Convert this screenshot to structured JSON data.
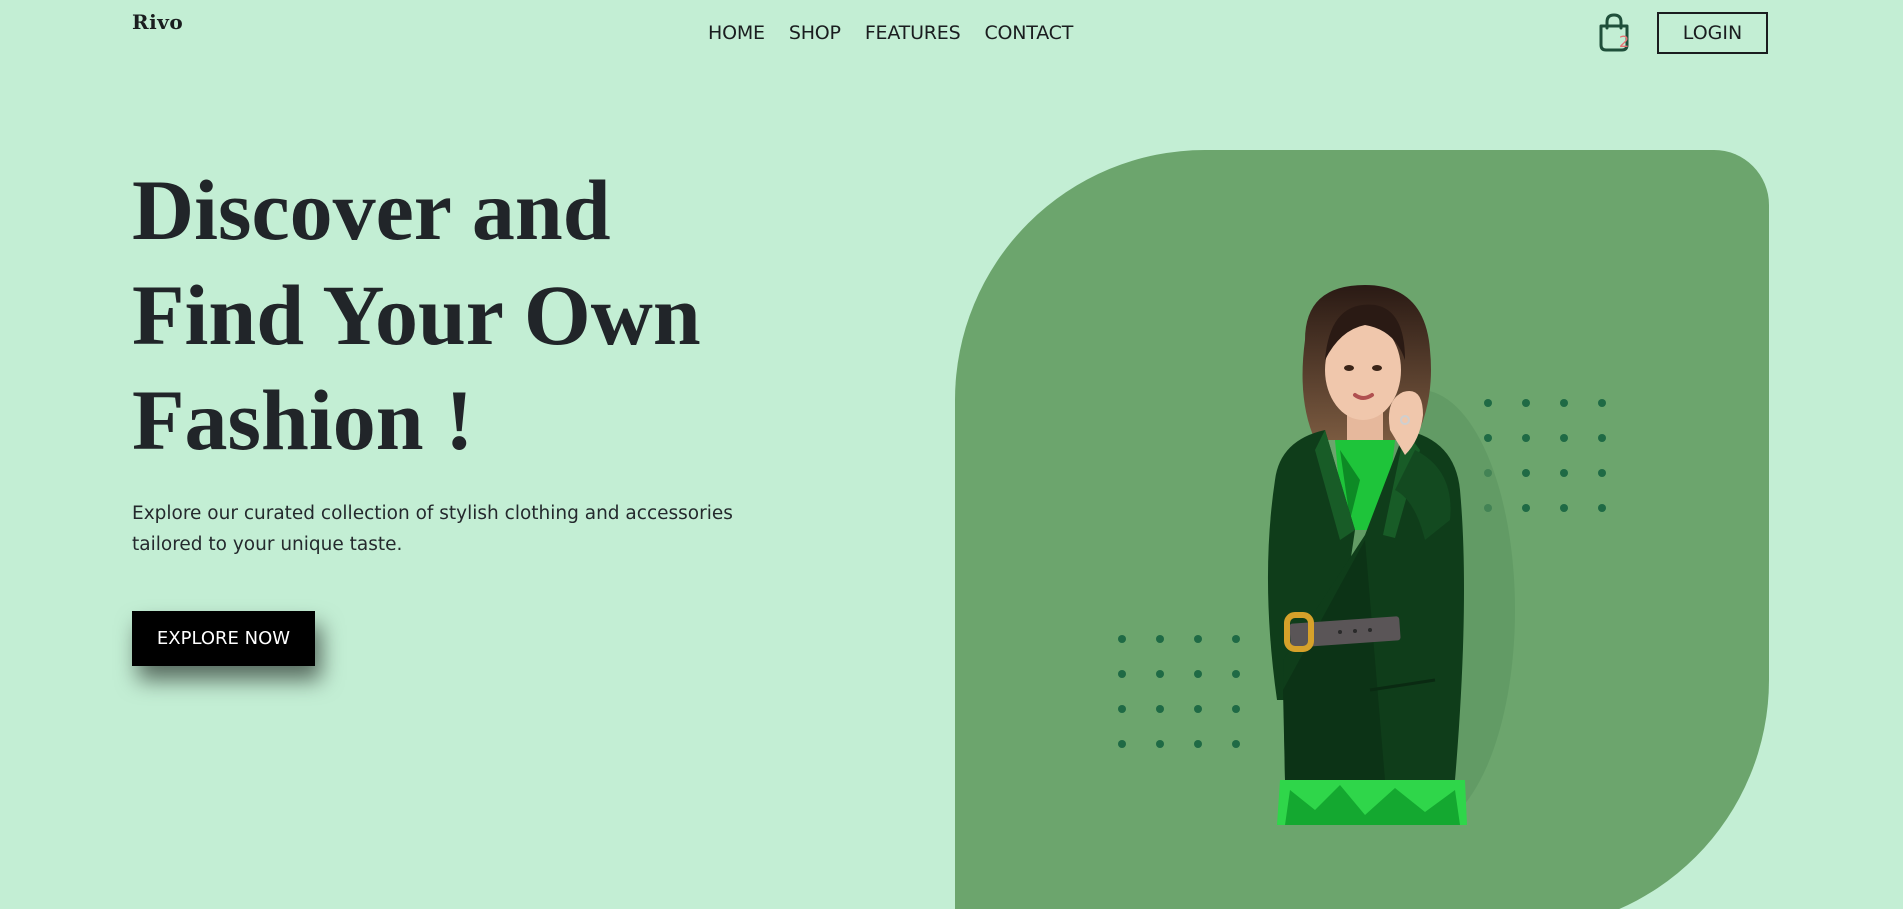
{
  "brand": {
    "name": "Rivo"
  },
  "nav": {
    "items": [
      {
        "label": "HOME"
      },
      {
        "label": "SHOP"
      },
      {
        "label": "FEATURES"
      },
      {
        "label": "CONTACT"
      }
    ]
  },
  "cart": {
    "count": "2",
    "icon": "shopping-bag-icon"
  },
  "login": {
    "label": "LOGIN"
  },
  "hero": {
    "title_lines": [
      "Discover and",
      "Find Your Own",
      "Fashion !"
    ],
    "description": "Explore our curated collection of stylish clothing and accessories tailored to your unique taste.",
    "cta_label": "EXPLORE NOW"
  },
  "colors": {
    "background": "#c3eed4",
    "blob": "#6ca56d",
    "dots": "#1f6a45",
    "cta_bg": "#000000",
    "cart_badge": "#e57373"
  }
}
